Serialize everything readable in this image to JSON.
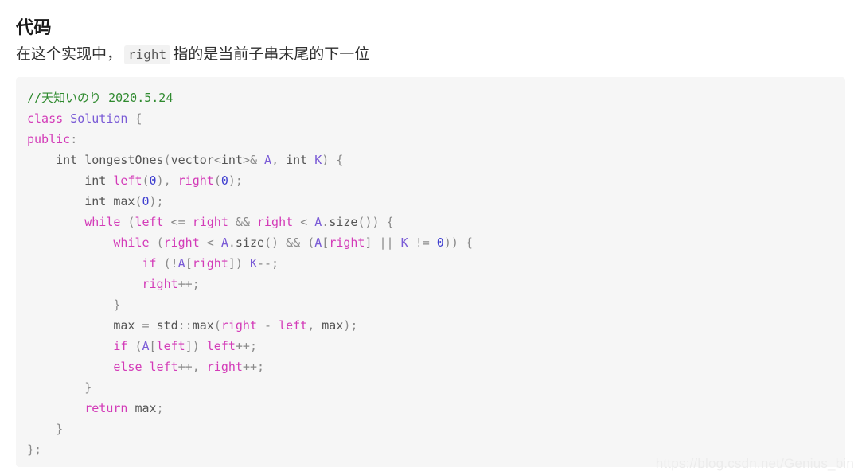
{
  "heading": "代码",
  "paragraph": {
    "before": "在这个实现中，",
    "inline_code": "right",
    "after": "指的是当前子串末尾的下一位"
  },
  "code_block": {
    "language": "cpp",
    "background": "#f6f6f6",
    "colors": {
      "comment": "#2f8a2f",
      "keyword": "#d33bb8",
      "type": "#7a5bd6",
      "variable": "#d33bb8",
      "number": "#3f3fd0",
      "plain": "#555555"
    },
    "lines": [
      "//天知いのり 2020.5.24",
      "class Solution {",
      "public:",
      "    int longestOnes(vector<int>& A, int K) {",
      "        int left(0), right(0);",
      "        int max(0);",
      "        while (left <= right && right < A.size()) {",
      "            while (right < A.size() && (A[right] || K != 0)) {",
      "                if (!A[right]) K--;",
      "                right++;",
      "            }",
      "            max = std::max(right - left, max);",
      "            if (A[left]) left++;",
      "            else left++, right++;",
      "        }",
      "        return max;",
      "    }",
      "};"
    ]
  },
  "watermark": "https://blog.csdn.net/Genius_bin"
}
